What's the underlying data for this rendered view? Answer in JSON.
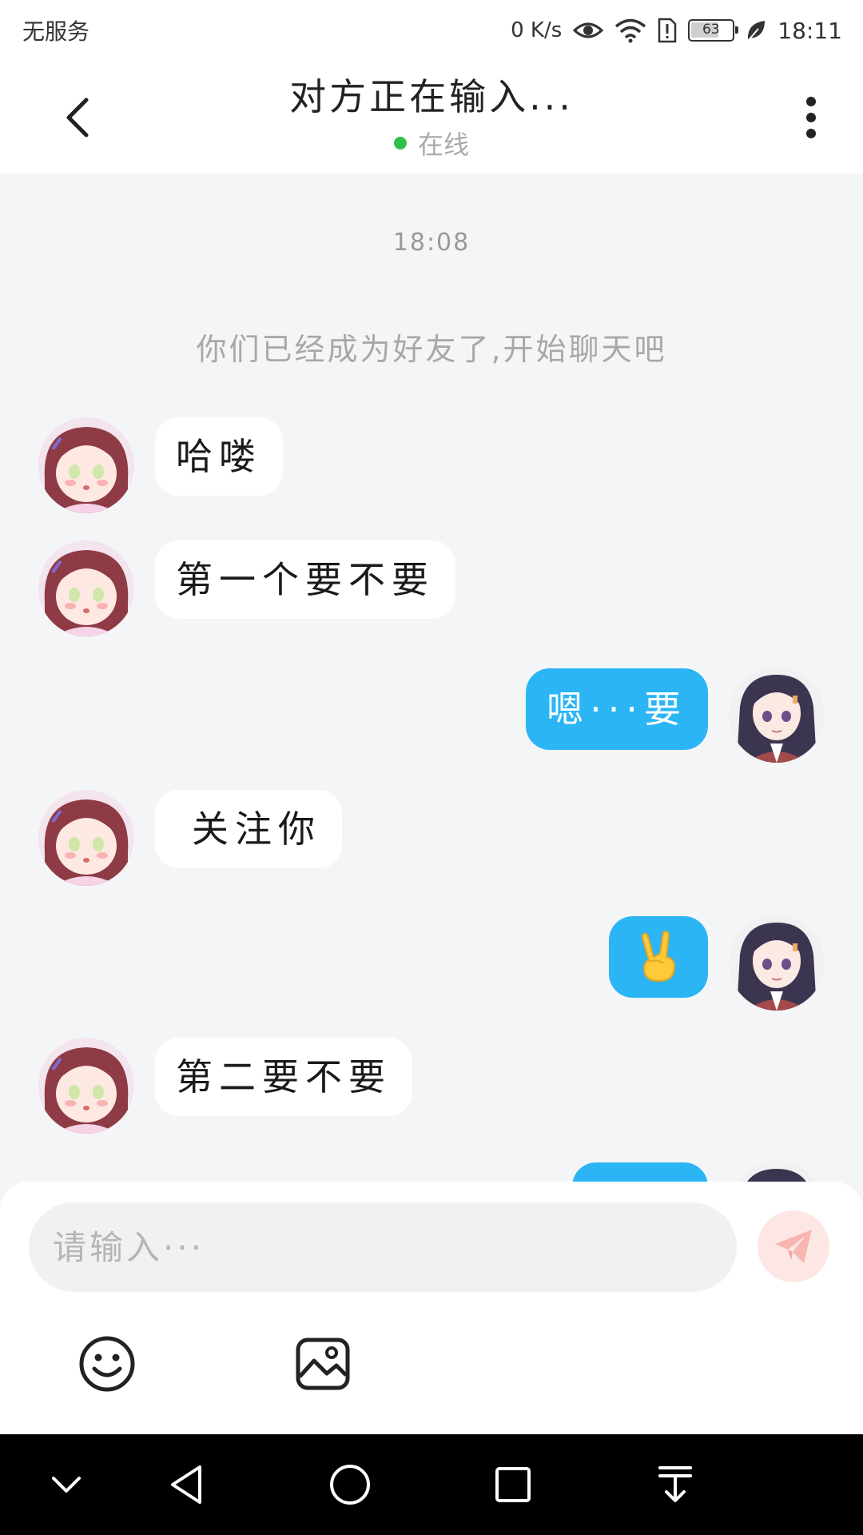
{
  "status_bar": {
    "carrier": "无服务",
    "net_speed": "0 K/s",
    "battery": "63",
    "time": "18:11"
  },
  "header": {
    "title": "对方正在输入...",
    "status_text": "在线",
    "status_color": "#2fc24a"
  },
  "chat": {
    "timestamp": "18:08",
    "system_message": "你们已经成为好友了,开始聊天吧",
    "messages": [
      {
        "side": "left",
        "text": "哈喽"
      },
      {
        "side": "left",
        "text": "第一个要不要"
      },
      {
        "side": "right",
        "text": "嗯···要"
      },
      {
        "side": "left",
        "text": "关注你"
      },
      {
        "side": "right",
        "text": "✌️"
      },
      {
        "side": "left",
        "text": "第二要不要"
      },
      {
        "side": "right",
        "text": ""
      }
    ]
  },
  "input": {
    "placeholder": "请输入···",
    "value": ""
  },
  "colors": {
    "outgoing_bubble": "#2bb5f5",
    "incoming_bubble": "#ffffff",
    "send_button": "#fde7e5"
  },
  "icons": {
    "back": "back-arrow-icon",
    "more": "more-vertical-icon",
    "send": "send-paper-plane-icon",
    "emoji": "smiley-icon",
    "image": "image-icon"
  }
}
